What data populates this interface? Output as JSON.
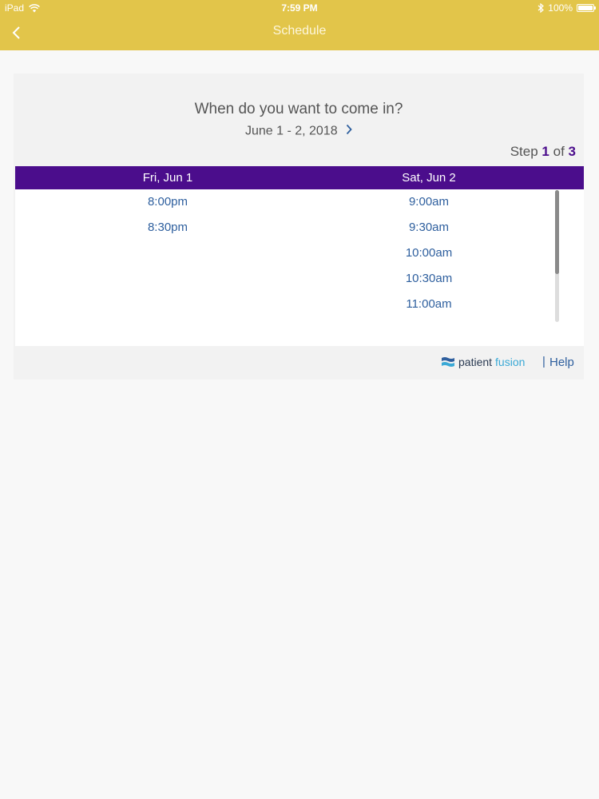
{
  "status_bar": {
    "device": "iPad",
    "time": "7:59 PM",
    "battery": "100%"
  },
  "nav": {
    "title": "Schedule"
  },
  "scheduler": {
    "question": "When do you want to come in?",
    "date_range": "June 1 - 2, 2018",
    "step_label": "Step",
    "step_current": "1",
    "step_of": "of",
    "step_total": "3",
    "days": [
      {
        "label": "Fri, Jun 1",
        "slots": [
          "8:00pm",
          "8:30pm"
        ]
      },
      {
        "label": "Sat, Jun 2",
        "slots": [
          "9:00am",
          "9:30am",
          "10:00am",
          "10:30am",
          "11:00am"
        ]
      }
    ]
  },
  "footer": {
    "logo_patient": "patient",
    "logo_fusion": "fusion",
    "divider": "|",
    "help": "Help"
  },
  "colors": {
    "header": "#e2c54a",
    "day_header": "#4b0d8c",
    "link": "#2e5f9e"
  }
}
